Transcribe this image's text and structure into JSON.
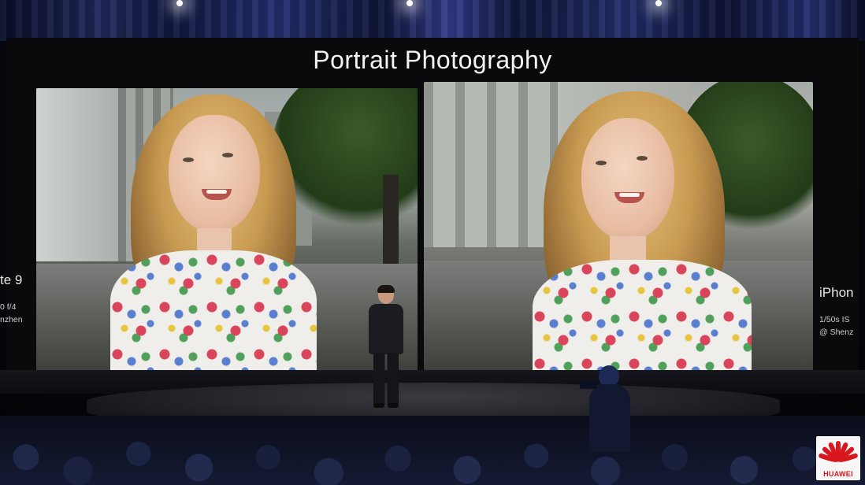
{
  "slide": {
    "title": "Portrait Photography"
  },
  "left_caption": {
    "model": "te 9",
    "exposure": "0  f/4",
    "location": "nzhen"
  },
  "right_caption": {
    "model": "iPhon",
    "exposure": "1/50s   IS",
    "location": "@ Shenz"
  },
  "logo": {
    "text": "HUAWEI",
    "color": "#d8171e"
  }
}
